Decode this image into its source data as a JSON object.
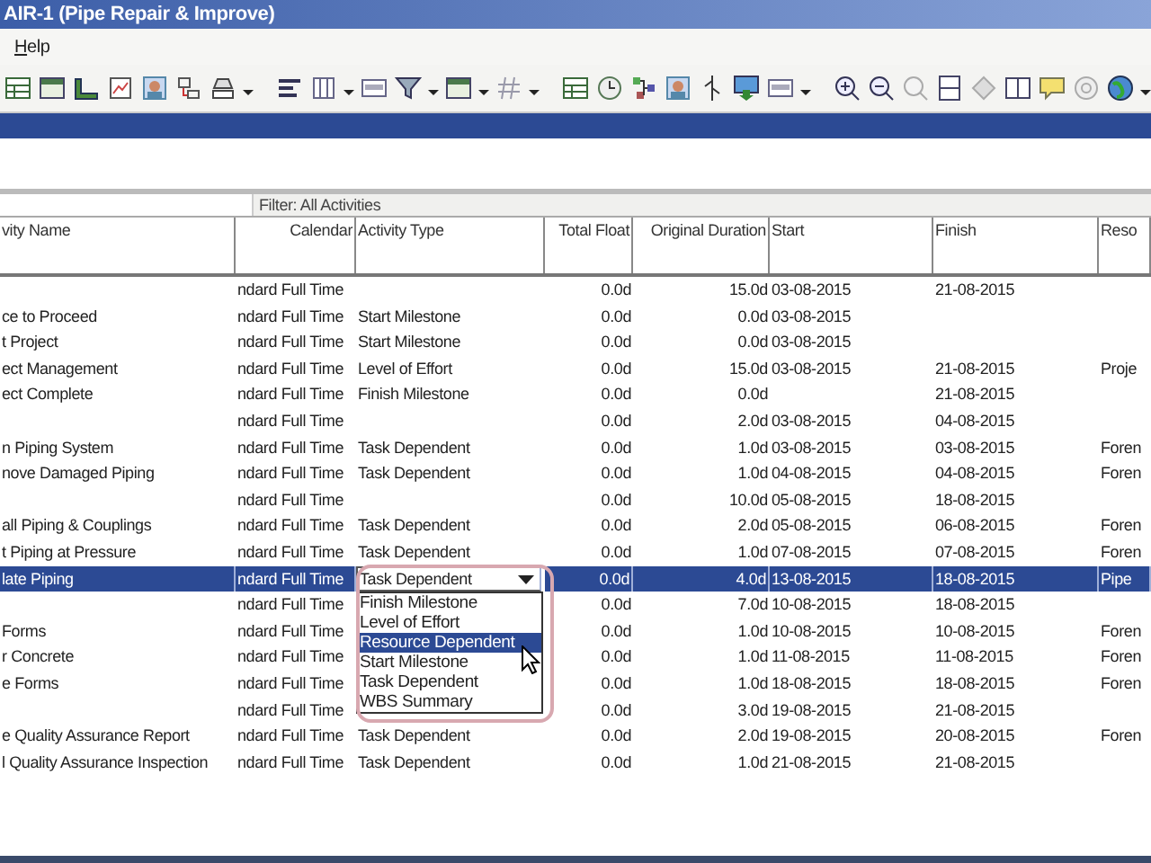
{
  "window": {
    "title": "AIR-1 (Pipe Repair & Improve)"
  },
  "menu": [
    {
      "label": "Help"
    }
  ],
  "filter": {
    "label": "Filter: All Activities"
  },
  "table": {
    "columns": [
      "vity Name",
      "Calendar",
      "Activity Type",
      "Total Float",
      "Original Duration",
      "Start",
      "Finish",
      "Reso"
    ],
    "rows": [
      {
        "calendar": "ndard Full Time",
        "total_float": "0.0d",
        "duration": "15.0d",
        "start": "03-08-2015",
        "finish": "21-08-2015",
        "selected": false
      },
      {
        "name": "ce to Proceed",
        "calendar": "ndard Full Time",
        "type": "Start Milestone",
        "total_float": "0.0d",
        "duration": "0.0d",
        "start": "03-08-2015",
        "selected": false
      },
      {
        "name": "t Project",
        "calendar": "ndard Full Time",
        "type": "Start Milestone",
        "total_float": "0.0d",
        "duration": "0.0d",
        "start": "03-08-2015",
        "selected": false
      },
      {
        "name": "ect Management",
        "calendar": "ndard Full Time",
        "type": "Level of Effort",
        "total_float": "0.0d",
        "duration": "15.0d",
        "start": "03-08-2015",
        "finish": "21-08-2015",
        "resource": "Proje",
        "selected": false
      },
      {
        "name": "ect Complete",
        "calendar": "ndard Full Time",
        "type": "Finish Milestone",
        "total_float": "0.0d",
        "duration": "0.0d",
        "finish": "21-08-2015",
        "selected": false
      },
      {
        "calendar": "ndard Full Time",
        "total_float": "0.0d",
        "duration": "2.0d",
        "start": "03-08-2015",
        "finish": "04-08-2015",
        "selected": false
      },
      {
        "name": "n Piping System",
        "calendar": "ndard Full Time",
        "type": "Task Dependent",
        "total_float": "0.0d",
        "duration": "1.0d",
        "start": "03-08-2015",
        "finish": "03-08-2015",
        "resource": "Foren",
        "selected": false
      },
      {
        "name": "nove Damaged Piping",
        "calendar": "ndard Full Time",
        "type": "Task Dependent",
        "total_float": "0.0d",
        "duration": "1.0d",
        "start": "04-08-2015",
        "finish": "04-08-2015",
        "resource": "Foren",
        "selected": false
      },
      {
        "calendar": "ndard Full Time",
        "total_float": "0.0d",
        "duration": "10.0d",
        "start": "05-08-2015",
        "finish": "18-08-2015",
        "selected": false
      },
      {
        "name": "all Piping & Couplings",
        "calendar": "ndard Full Time",
        "type": "Task Dependent",
        "total_float": "0.0d",
        "duration": "2.0d",
        "start": "05-08-2015",
        "finish": "06-08-2015",
        "resource": "Foren",
        "selected": false
      },
      {
        "name": "t Piping at Pressure",
        "calendar": "ndard Full Time",
        "type": "Task Dependent",
        "total_float": "0.0d",
        "duration": "1.0d",
        "start": "07-08-2015",
        "finish": "07-08-2015",
        "resource": "Foren",
        "selected": false
      },
      {
        "name": "late Piping",
        "calendar": "ndard Full Time",
        "type": "Task Dependent",
        "total_float": "0.0d",
        "duration": "4.0d",
        "start": "13-08-2015",
        "finish": "18-08-2015",
        "resource": "Pipe",
        "selected": true
      },
      {
        "calendar": "ndard Full Time",
        "total_float": "0.0d",
        "duration": "7.0d",
        "start": "10-08-2015",
        "finish": "18-08-2015",
        "selected": false
      },
      {
        "name": "Forms",
        "calendar": "ndard Full Time",
        "total_float": "0.0d",
        "duration": "1.0d",
        "start": "10-08-2015",
        "finish": "10-08-2015",
        "resource": "Foren",
        "selected": false
      },
      {
        "name": "r Concrete",
        "calendar": "ndard Full Time",
        "total_float": "0.0d",
        "duration": "1.0d",
        "start": "11-08-2015",
        "finish": "11-08-2015",
        "resource": "Foren",
        "selected": false
      },
      {
        "name": "e Forms",
        "calendar": "ndard Full Time",
        "total_float": "0.0d",
        "duration": "1.0d",
        "start": "18-08-2015",
        "finish": "18-08-2015",
        "resource": "Foren",
        "selected": false
      },
      {
        "calendar": "ndard Full Time",
        "total_float": "0.0d",
        "duration": "3.0d",
        "start": "19-08-2015",
        "finish": "21-08-2015",
        "selected": false
      },
      {
        "name": "e Quality Assurance Report",
        "calendar": "ndard Full Time",
        "type": "Task Dependent",
        "total_float": "0.0d",
        "duration": "2.0d",
        "start": "19-08-2015",
        "finish": "20-08-2015",
        "resource": "Foren",
        "selected": false
      },
      {
        "name": "l Quality Assurance Inspection",
        "calendar": "ndard Full Time",
        "type": "Task Dependent",
        "total_float": "0.0d",
        "duration": "1.0d",
        "start": "21-08-2015",
        "finish": "21-08-2015",
        "selected": false
      }
    ]
  },
  "type_dropdown": {
    "options": [
      {
        "label": "Finish Milestone",
        "selected": false
      },
      {
        "label": "Level of Effort",
        "selected": false
      },
      {
        "label": "Resource Dependent",
        "selected": true
      },
      {
        "label": "Start Milestone",
        "selected": false
      },
      {
        "label": "Task Dependent",
        "selected": false
      },
      {
        "label": "WBS Summary",
        "selected": false
      }
    ]
  }
}
